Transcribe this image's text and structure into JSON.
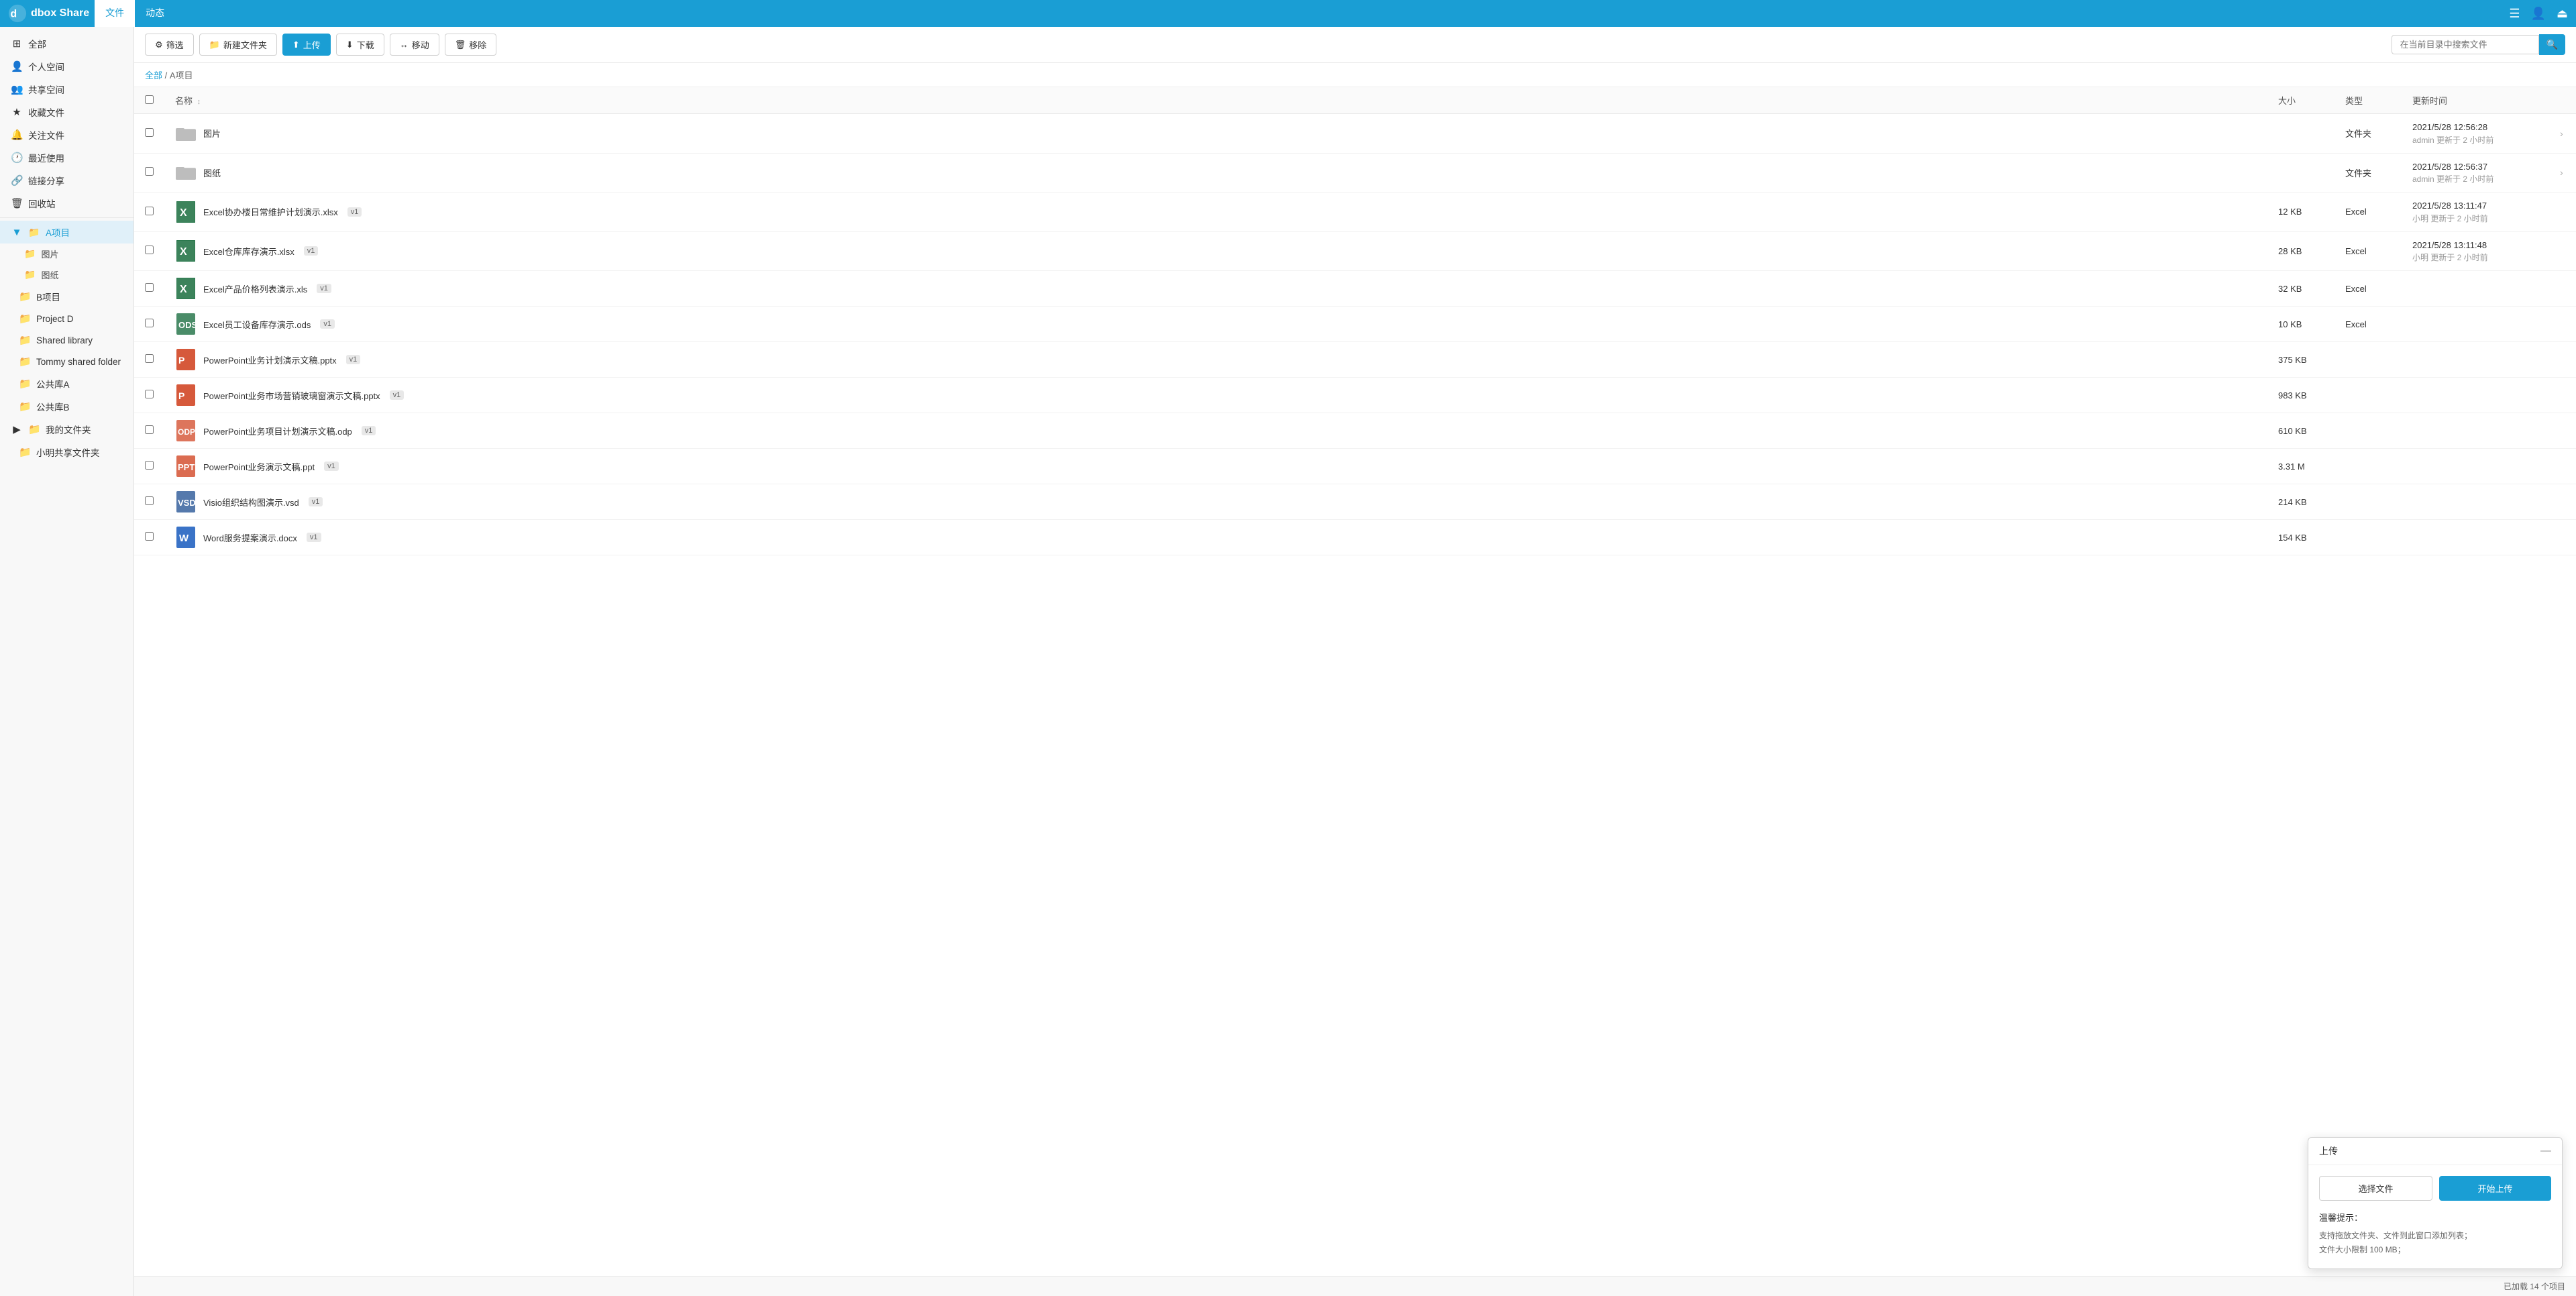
{
  "app": {
    "name": "dbox Share",
    "logo_text": "dbox Share"
  },
  "nav": {
    "tabs": [
      {
        "id": "files",
        "label": "文件",
        "active": true
      },
      {
        "id": "activity",
        "label": "动态",
        "active": false
      }
    ],
    "search_placeholder": "在当前目录中搜索文件",
    "icons": [
      "menu-icon",
      "user-icon",
      "logout-icon"
    ]
  },
  "sidebar": {
    "items": [
      {
        "id": "all",
        "label": "全部",
        "icon": "⊞"
      },
      {
        "id": "personal",
        "label": "个人空间",
        "icon": "👤"
      },
      {
        "id": "shared-space",
        "label": "共享空间",
        "icon": "👥"
      },
      {
        "id": "favorites",
        "label": "收藏文件",
        "icon": "★"
      },
      {
        "id": "attention",
        "label": "关注文件",
        "icon": "🔔"
      },
      {
        "id": "recent",
        "label": "最近使用",
        "icon": "🕐"
      },
      {
        "id": "link-share",
        "label": "链接分享",
        "icon": "🔗"
      },
      {
        "id": "trash",
        "label": "回收站",
        "icon": "🗑"
      }
    ],
    "tree": {
      "label": "A项目",
      "expanded": true,
      "children": [
        {
          "label": "图片"
        },
        {
          "label": "图纸"
        }
      ]
    },
    "extra_items": [
      {
        "label": "B项目"
      },
      {
        "label": "Project D"
      },
      {
        "label": "Shared library"
      },
      {
        "label": "Tommy shared folder"
      },
      {
        "label": "公共库A"
      },
      {
        "label": "公共库B"
      },
      {
        "label": "我的文件夹",
        "expandable": true
      },
      {
        "label": "小明共享文件夹"
      }
    ]
  },
  "toolbar": {
    "filter_label": "筛选",
    "new_folder_label": "新建文件夹",
    "upload_label": "上传",
    "download_label": "下载",
    "move_label": "移动",
    "delete_label": "移除",
    "search_placeholder": "在当前目录中搜索文件"
  },
  "breadcrumb": {
    "parts": [
      "全部",
      "A项目"
    ]
  },
  "table": {
    "headers": [
      "名称",
      "大小",
      "类型",
      "更新时间"
    ],
    "rows": [
      {
        "type": "folder",
        "name": "图片",
        "size": "",
        "file_type": "文件夹",
        "updated": "2021/5/28 12:56:28",
        "updater": "admin 更新于 2 小时前"
      },
      {
        "type": "folder",
        "name": "图纸",
        "size": "",
        "file_type": "文件夹",
        "updated": "2021/5/28 12:56:37",
        "updater": "admin 更新于 2 小时前"
      },
      {
        "type": "excel",
        "name": "Excel协办楼日常维护计划演示.xlsx",
        "version": "v1",
        "size": "12 KB",
        "file_type": "Excel",
        "updated": "2021/5/28 13:11:47",
        "updater": "小明 更新于 2 小时前"
      },
      {
        "type": "excel",
        "name": "Excel仓库库存演示.xlsx",
        "version": "v1",
        "size": "28 KB",
        "file_type": "Excel",
        "updated": "2021/5/28 13:11:48",
        "updater": "小明 更新于 2 小时前"
      },
      {
        "type": "excel",
        "name": "Excel产品价格列表演示.xls",
        "version": "v1",
        "size": "32 KB",
        "file_type": "Excel",
        "updated": "",
        "updater": ""
      },
      {
        "type": "ods",
        "name": "Excel员工设备库存演示.ods",
        "version": "v1",
        "size": "10 KB",
        "file_type": "Excel",
        "updated": "",
        "updater": ""
      },
      {
        "type": "pptx",
        "name": "PowerPoint业务计划演示文稿.pptx",
        "version": "v1",
        "size": "375 KB",
        "file_type": "",
        "updated": "",
        "updater": ""
      },
      {
        "type": "pptx",
        "name": "PowerPoint业务市场营销玻璃窗演示文稿.pptx",
        "version": "v1",
        "size": "983 KB",
        "file_type": "",
        "updated": "",
        "updater": ""
      },
      {
        "type": "odp",
        "name": "PowerPoint业务项目计划演示文稿.odp",
        "version": "v1",
        "size": "610 KB",
        "file_type": "",
        "updated": "",
        "updater": ""
      },
      {
        "type": "ppt",
        "name": "PowerPoint业务演示文稿.ppt",
        "version": "v1",
        "size": "3.31 M",
        "file_type": "",
        "updated": "",
        "updater": ""
      },
      {
        "type": "vsd",
        "name": "Visio组织结构图演示.vsd",
        "version": "v1",
        "size": "214 KB",
        "file_type": "",
        "updated": "",
        "updater": ""
      },
      {
        "type": "docx",
        "name": "Word服务提案演示.docx",
        "version": "v1",
        "size": "154 KB",
        "file_type": "",
        "updated": "",
        "updater": ""
      }
    ]
  },
  "status_bar": {
    "text": "已加载 14 个项目"
  },
  "upload_dialog": {
    "title": "上传",
    "select_btn": "选择文件",
    "start_btn": "开始上传",
    "hint_title": "温馨提示：",
    "hint_lines": [
      "支持拖放文件夹、文件到此窗口添加列表；",
      "文件大小限制 100 MB；"
    ]
  }
}
